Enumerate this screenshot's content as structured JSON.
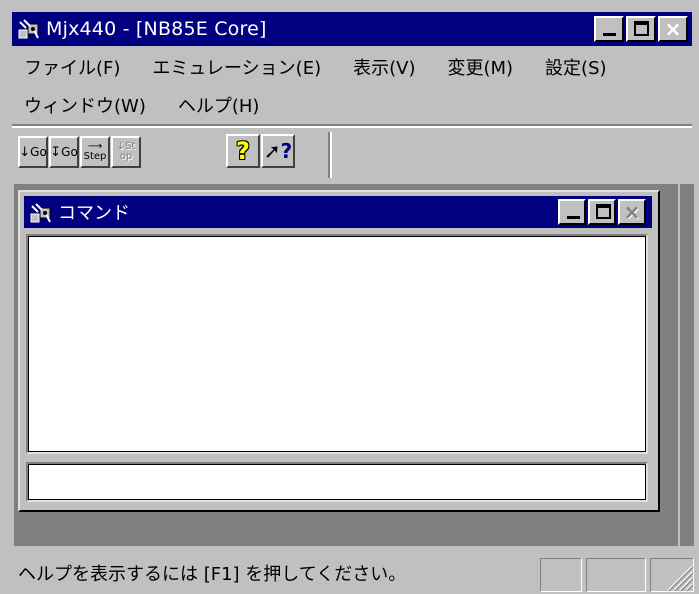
{
  "window": {
    "title": "Mjx440 - [NB85E Core]",
    "icon": "app-icon"
  },
  "menu": {
    "row1": [
      "ファイル(F)",
      "エミュレーション(E)",
      "表示(V)",
      "変更(M)",
      "設定(S)"
    ],
    "row2": [
      "ウィンドウ(W)",
      "ヘルプ(H)"
    ]
  },
  "toolbar": {
    "buttons": [
      {
        "name": "go-button",
        "label": "↓Go",
        "enabled": true
      },
      {
        "name": "step-go-button",
        "label": "↧Go",
        "enabled": true
      },
      {
        "name": "step-button",
        "label": "Step",
        "enabled": true
      },
      {
        "name": "stop-button",
        "label": "Stop",
        "enabled": false
      },
      {
        "name": "help-button",
        "label": "?",
        "enabled": true
      },
      {
        "name": "context-help-button",
        "label": "↖?",
        "enabled": true
      }
    ]
  },
  "child": {
    "title": "コマンド",
    "output_text": "",
    "input_value": ""
  },
  "status": {
    "text": "ヘルプを表示するには [F1] を押してください。"
  },
  "colors": {
    "titlebar": "#000080",
    "face": "#c0c0c0",
    "mdi": "#808080"
  }
}
